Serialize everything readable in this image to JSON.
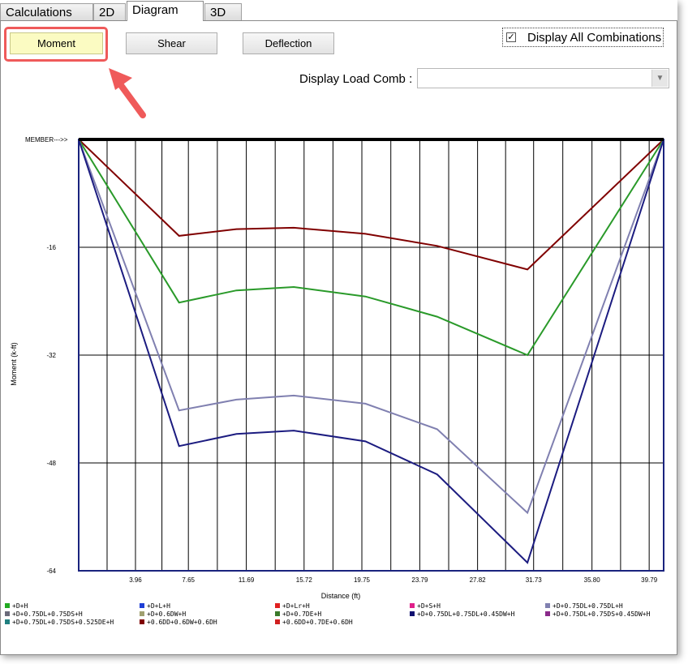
{
  "tabs": [
    {
      "label": "Calculations",
      "active": false
    },
    {
      "label": "2D",
      "active": false
    },
    {
      "label": "Diagram",
      "active": true
    },
    {
      "label": "3D",
      "active": false
    }
  ],
  "toolbar": {
    "moment_label": "Moment",
    "shear_label": "Shear",
    "deflection_label": "Deflection",
    "selected": "Moment"
  },
  "display_all": {
    "label": "Display All Combinations",
    "checked": true,
    "mark": "✓"
  },
  "load_comb": {
    "label": "Display Load Comb :",
    "value": "",
    "arrow": "▼"
  },
  "colors": {
    "highlight": "#ef5a5a",
    "selected_button": "#fbfbc2",
    "plot_border": "#1a237e",
    "member_line": "#000000"
  },
  "chart_data": {
    "type": "line",
    "member_label": "MEMBER--->>",
    "xlabel": "Distance (ft)",
    "ylabel": "Moment (k-ft)",
    "xlim": [
      0,
      40.8
    ],
    "ylim": [
      -64,
      0
    ],
    "x_ticks": [
      "3.96",
      "7.65",
      "11.69",
      "15.72",
      "19.75",
      "23.79",
      "27.82",
      "31.73",
      "35.80",
      "39.79"
    ],
    "x_tick_values": [
      3.96,
      7.65,
      11.69,
      15.72,
      19.75,
      23.79,
      27.82,
      31.73,
      35.8,
      39.79
    ],
    "y_ticks": [
      "-16",
      "-32",
      "-48",
      "-64"
    ],
    "y_tick_values": [
      -16,
      -32,
      -48,
      -64
    ],
    "grid": true,
    "series": [
      {
        "color": "#800000",
        "x": [
          0,
          7.0,
          11.0,
          15.0,
          20.0,
          25.0,
          31.3,
          40.8
        ],
        "y": [
          0,
          -14.3,
          -13.3,
          -13.1,
          -14.0,
          -15.8,
          -19.3,
          0
        ]
      },
      {
        "color": "#2a9a2a",
        "x": [
          0,
          7.0,
          11.0,
          15.0,
          20.0,
          25.0,
          31.3,
          40.8
        ],
        "y": [
          0,
          -24.2,
          -22.4,
          -21.9,
          -23.3,
          -26.3,
          -32.0,
          0
        ]
      },
      {
        "color": "#8080b0",
        "x": [
          0,
          7.0,
          11.0,
          15.0,
          20.0,
          25.0,
          31.3,
          40.8
        ],
        "y": [
          0,
          -40.2,
          -38.6,
          -38.0,
          -39.2,
          -43.0,
          -55.4,
          0
        ]
      },
      {
        "color": "#1c1c80",
        "x": [
          0,
          7.0,
          11.0,
          15.0,
          20.0,
          25.0,
          31.3,
          40.8
        ],
        "y": [
          0,
          -45.5,
          -43.7,
          -43.2,
          -44.8,
          -49.7,
          -62.8,
          0
        ]
      }
    ]
  },
  "legend": [
    {
      "label": "+D+H",
      "color": "#22aa22"
    },
    {
      "label": "+D+L+H",
      "color": "#1f3fd6"
    },
    {
      "label": "+D+Lr+H",
      "color": "#e02020"
    },
    {
      "label": "+D+S+H",
      "color": "#e0208a"
    },
    {
      "label": "+D+0.75DL+0.75DL+H",
      "color": "#8080b0"
    },
    {
      "label": "+D+0.75DL+0.75DS+H",
      "color": "#6a6a7a"
    },
    {
      "label": "+D+0.6DW+H",
      "color": "#a0a070"
    },
    {
      "label": "+D+0.7DE+H",
      "color": "#3a7a2a"
    },
    {
      "label": "+D+0.75DL+0.75DL+0.45DW+H",
      "color": "#101070"
    },
    {
      "label": "+D+0.75DL+0.75DS+0.45DW+H",
      "color": "#8a2a8a"
    },
    {
      "label": "+D+0.75DL+0.75DS+0.525DE+H",
      "color": "#208080"
    },
    {
      "label": "+0.6DD+0.6DW+0.6DH",
      "color": "#800000"
    },
    {
      "label": "+0.6DD+0.7DE+0.6DH",
      "color": "#d02020"
    }
  ]
}
